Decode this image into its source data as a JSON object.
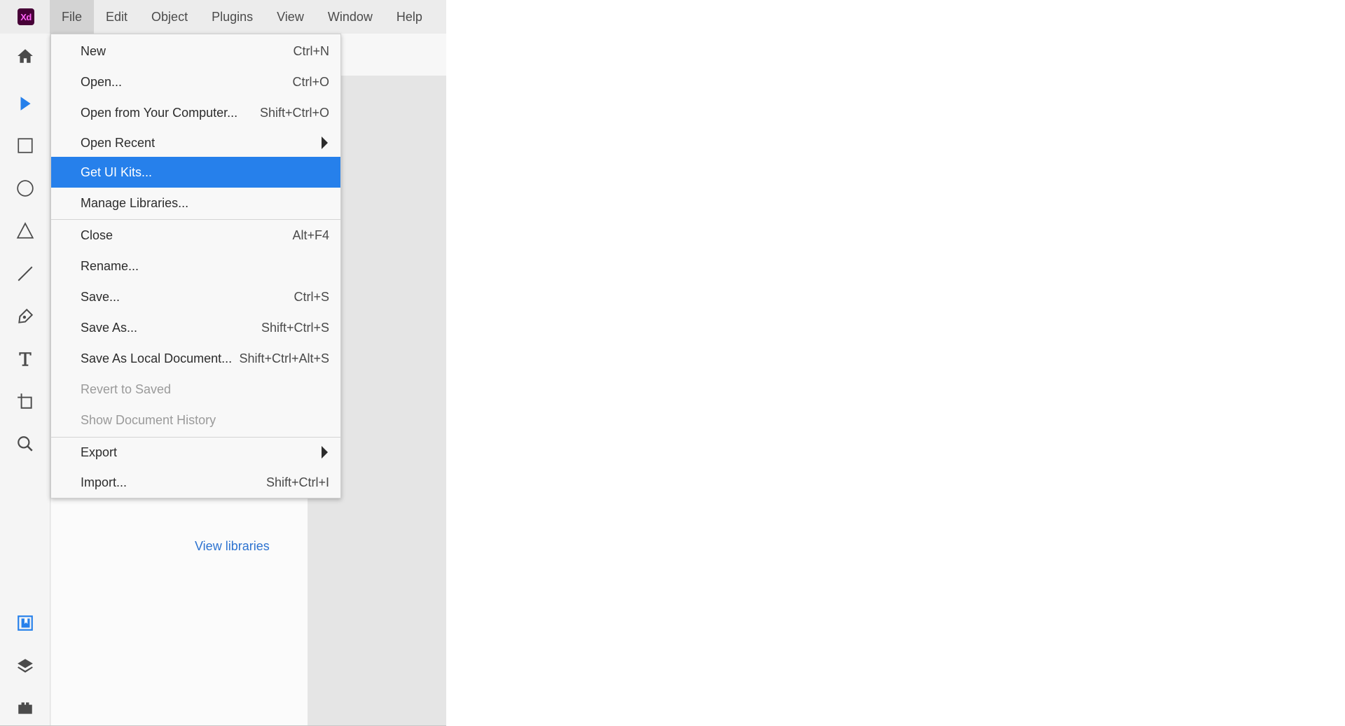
{
  "app": {
    "logo_text": "Xd",
    "brand_color": "#470137",
    "accent_color": "#2680eb"
  },
  "menubar": {
    "items": [
      {
        "label": "File",
        "active": true
      },
      {
        "label": "Edit"
      },
      {
        "label": "Object"
      },
      {
        "label": "Plugins"
      },
      {
        "label": "View"
      },
      {
        "label": "Window"
      },
      {
        "label": "Help"
      }
    ]
  },
  "toolrail": {
    "tools": [
      {
        "icon": "home-icon"
      },
      {
        "icon": "select-arrow-icon",
        "active": true
      },
      {
        "icon": "rectangle-icon"
      },
      {
        "icon": "ellipse-icon"
      },
      {
        "icon": "triangle-icon"
      },
      {
        "icon": "line-icon"
      },
      {
        "icon": "pen-icon"
      },
      {
        "icon": "text-icon"
      },
      {
        "icon": "artboard-icon"
      },
      {
        "icon": "zoom-icon"
      },
      {
        "icon": "libraries-icon"
      },
      {
        "icon": "layers-icon"
      },
      {
        "icon": "plugins-icon"
      }
    ]
  },
  "panel": {
    "view_libraries_link": "View libraries"
  },
  "file_menu": {
    "items": [
      {
        "label": "New",
        "shortcut": "Ctrl+N"
      },
      {
        "label": "Open...",
        "shortcut": "Ctrl+O"
      },
      {
        "label": "Open from Your Computer...",
        "shortcut": "Shift+Ctrl+O"
      },
      {
        "label": "Open Recent",
        "submenu": true
      },
      {
        "label": "Get UI Kits...",
        "highlighted": true
      },
      {
        "label": "Manage Libraries..."
      },
      {
        "label": "Close",
        "shortcut": "Alt+F4"
      },
      {
        "label": "Rename..."
      },
      {
        "label": "Save...",
        "shortcut": "Ctrl+S"
      },
      {
        "label": "Save As...",
        "shortcut": "Shift+Ctrl+S"
      },
      {
        "label": "Save As Local Document...",
        "shortcut": "Shift+Ctrl+Alt+S"
      },
      {
        "label": "Revert to Saved",
        "disabled": true
      },
      {
        "label": "Show Document History",
        "disabled": true
      },
      {
        "label": "Export",
        "submenu": true
      },
      {
        "label": "Import...",
        "shortcut": "Shift+Ctrl+I"
      }
    ]
  }
}
